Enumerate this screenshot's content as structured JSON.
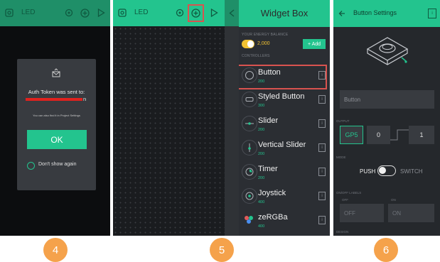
{
  "panel1": {
    "title": "LED",
    "dialog": {
      "message": "Auth Token was sent to:",
      "email_suffix": "n",
      "hint": "You can also find it in Project Settings",
      "ok_label": "OK",
      "checkbox_label": "Don't show again"
    }
  },
  "panel2": {
    "title": "LED"
  },
  "panel3": {
    "title": "Widget Box",
    "energy_section": "YOUR ENERGY BALANCE",
    "energy_value": "2,000",
    "add_label": "+ Add",
    "controllers_section": "CONTROLLERS",
    "widgets": [
      {
        "name": "Button",
        "cost": "200",
        "icon": "button-circle-icon"
      },
      {
        "name": "Styled Button",
        "cost": "300",
        "icon": "styled-button-icon"
      },
      {
        "name": "Slider",
        "cost": "200",
        "icon": "slider-icon"
      },
      {
        "name": "Vertical Slider",
        "cost": "200",
        "icon": "vertical-slider-icon"
      },
      {
        "name": "Timer",
        "cost": "200",
        "icon": "timer-icon"
      },
      {
        "name": "Joystick",
        "cost": "400",
        "icon": "joystick-icon"
      },
      {
        "name": "zeRGBa",
        "cost": "400",
        "icon": "zergba-icon"
      }
    ],
    "info_glyph": "i"
  },
  "panel4": {
    "title": "Button Settings",
    "name_placeholder": "Button",
    "output_section": "OUTPUT",
    "pin": "GP5",
    "low_value": "0",
    "high_value": "1",
    "mode_section": "MODE",
    "mode_push": "PUSH",
    "mode_switch": "SWITCH",
    "onoff_section": "ON/OFF LABELS",
    "off_caption": "OFF",
    "on_caption": "ON",
    "off_value": "OFF",
    "on_value": "ON",
    "design_section": "DESIGN"
  },
  "steps": [
    "4",
    "5",
    "6"
  ],
  "colors": {
    "accent": "#23c48e",
    "highlight": "#d9534f",
    "background": "#1c1e22",
    "step_badge": "#f5a24b"
  }
}
